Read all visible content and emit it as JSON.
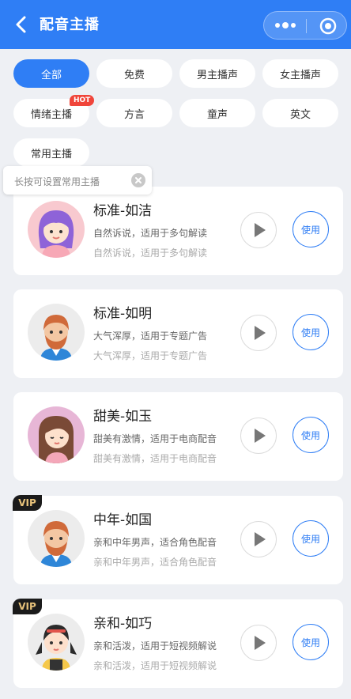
{
  "header": {
    "title": "配音主播"
  },
  "tabs": [
    {
      "label": "全部",
      "active": true
    },
    {
      "label": "免费"
    },
    {
      "label": "男主播声"
    },
    {
      "label": "女主播声"
    },
    {
      "label": "情绪主播",
      "badge": "HOT"
    },
    {
      "label": "方言"
    },
    {
      "label": "童声"
    },
    {
      "label": "英文"
    },
    {
      "label": "常用主播"
    }
  ],
  "tooltip": {
    "text": "长按可设置常用主播"
  },
  "voices": [
    {
      "name": "标准-如洁",
      "desc": "自然诉说，适用于多句解读",
      "use_label": "使用",
      "avatar": "girl-purple-hair"
    },
    {
      "name": "标准-如明",
      "desc": "大气浑厚，适用于专题广告",
      "use_label": "使用",
      "avatar": "man-beard"
    },
    {
      "name": "甜美-如玉",
      "desc": "甜美有激情，适用于电商配音",
      "use_label": "使用",
      "avatar": "woman-long-hair"
    },
    {
      "name": "中年-如国",
      "desc": "亲和中年男声，适合角色配音",
      "use_label": "使用",
      "vip": "VIP",
      "avatar": "man-beard"
    },
    {
      "name": "亲和-如巧",
      "desc": "亲和活泼，适用于短视频解说",
      "use_label": "使用",
      "vip": "VIP",
      "avatar": "girl-pigtails"
    }
  ],
  "colors": {
    "primary": "#2f7ef5",
    "hot": "#f0453a",
    "vip_bg": "#1b1b1b",
    "vip_text": "#e7c27a"
  }
}
